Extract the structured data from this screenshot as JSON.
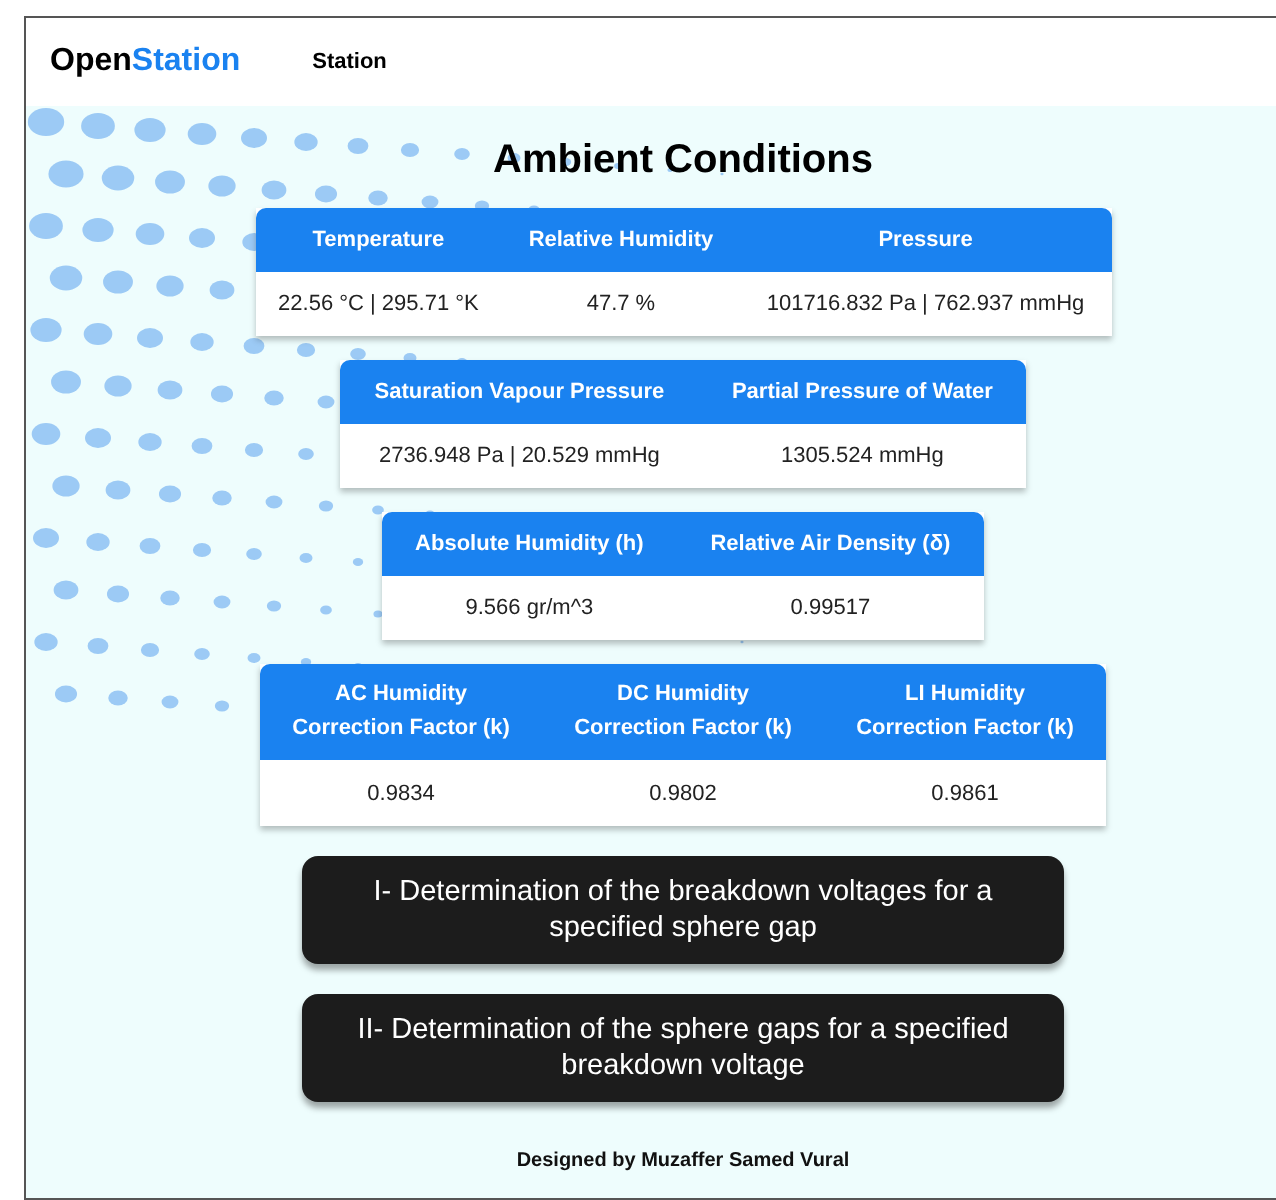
{
  "navbar": {
    "brand": {
      "first": "Open",
      "second": "Station"
    },
    "links": [
      "Station"
    ]
  },
  "title": "Ambient Conditions",
  "tables": [
    {
      "columns": [
        "Temperature",
        "Relative Humidity",
        "Pressure"
      ],
      "rows": [
        [
          "22.56 °C | 295.71 °K",
          "47.7 %",
          "101716.832 Pa | 762.937 mmHg"
        ]
      ]
    },
    {
      "columns": [
        "Saturation Vapour Pressure",
        "Partial Pressure of Water"
      ],
      "rows": [
        [
          "2736.948 Pa | 20.529 mmHg",
          "1305.524 mmHg"
        ]
      ]
    },
    {
      "columns": [
        "Absolute Humidity (h)",
        "Relative Air Density (δ)"
      ],
      "rows": [
        [
          "9.566 gr/m^3",
          "0.99517"
        ]
      ]
    },
    {
      "columns": [
        "AC Humidity\nCorrection Factor (k)",
        "DC Humidity\nCorrection Factor (k)",
        "LI Humidity\nCorrection Factor (k)"
      ],
      "rows": [
        [
          "0.9834",
          "0.9802",
          "0.9861"
        ]
      ]
    }
  ],
  "buttons": [
    "I- Determination of the breakdown voltages for a specified sphere gap",
    "II- Determination of the sphere gaps for a specified breakdown voltage"
  ],
  "footer": "Designed by Muzaffer Samed Vural"
}
